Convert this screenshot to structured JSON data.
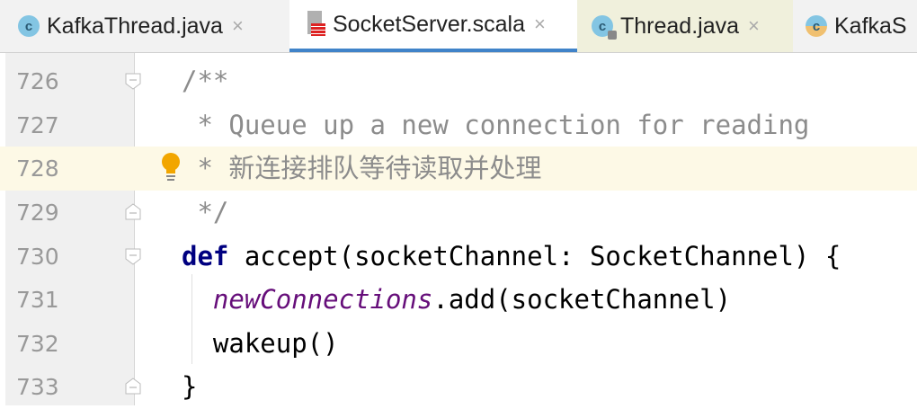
{
  "tabs": [
    {
      "label": "KafkaThread.java",
      "icon": "class-icon"
    },
    {
      "label": "SocketServer.scala",
      "icon": "scala-file-icon",
      "active": true
    },
    {
      "label": "Thread.java",
      "icon": "class-locked-icon"
    },
    {
      "label": "KafkaS",
      "icon": "class-icon"
    }
  ],
  "close_glyph": "×",
  "lines": [
    {
      "num": "726",
      "text": "/**"
    },
    {
      "num": "727",
      "text": " * Queue up a new connection for reading"
    },
    {
      "num": "728",
      "prefix": " * ",
      "text": "新连接排队等待读取并处理"
    },
    {
      "num": "729",
      "text": " */"
    },
    {
      "num": "730",
      "kw": "def",
      "text": " accept(socketChannel: SocketChannel) {"
    },
    {
      "num": "731",
      "indent": "  ",
      "field": "newConnections",
      "text": ".add(socketChannel)"
    },
    {
      "num": "732",
      "text": "  wakeup()"
    },
    {
      "num": "733",
      "text": "}"
    }
  ]
}
